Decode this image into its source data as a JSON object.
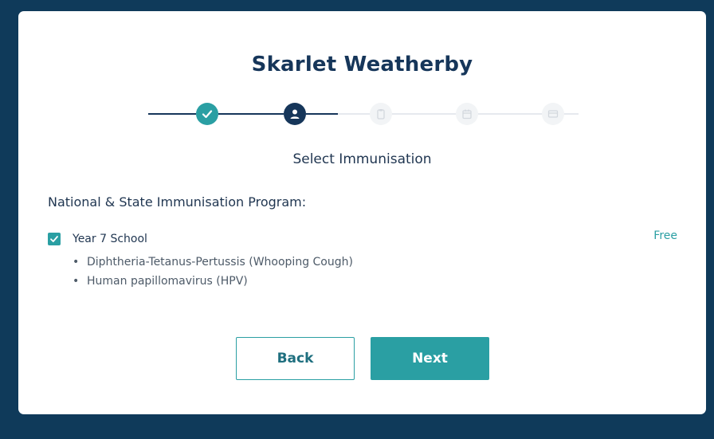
{
  "patient": {
    "name": "Skarlet Weatherby"
  },
  "stepper": {
    "steps": [
      {
        "status": "complete",
        "icon": "check-icon"
      },
      {
        "status": "current",
        "icon": "user-icon"
      },
      {
        "status": "pending",
        "icon": "clipboard-icon"
      },
      {
        "status": "pending",
        "icon": "calendar-icon"
      },
      {
        "status": "pending",
        "icon": "card-icon"
      }
    ]
  },
  "page": {
    "subtitle": "Select Immunisation",
    "section_label": "National & State Immunisation Program:"
  },
  "program": {
    "checked": true,
    "name": "Year 7 School",
    "price": "Free",
    "vaccines": [
      "Diphtheria-Tetanus-Pertussis (Whooping Cough)",
      "Human papillomavirus (HPV)"
    ]
  },
  "actions": {
    "back_label": "Back",
    "next_label": "Next"
  },
  "colors": {
    "background": "#0f3a5a",
    "navy": "#16365a",
    "teal": "#2a9fa3"
  }
}
